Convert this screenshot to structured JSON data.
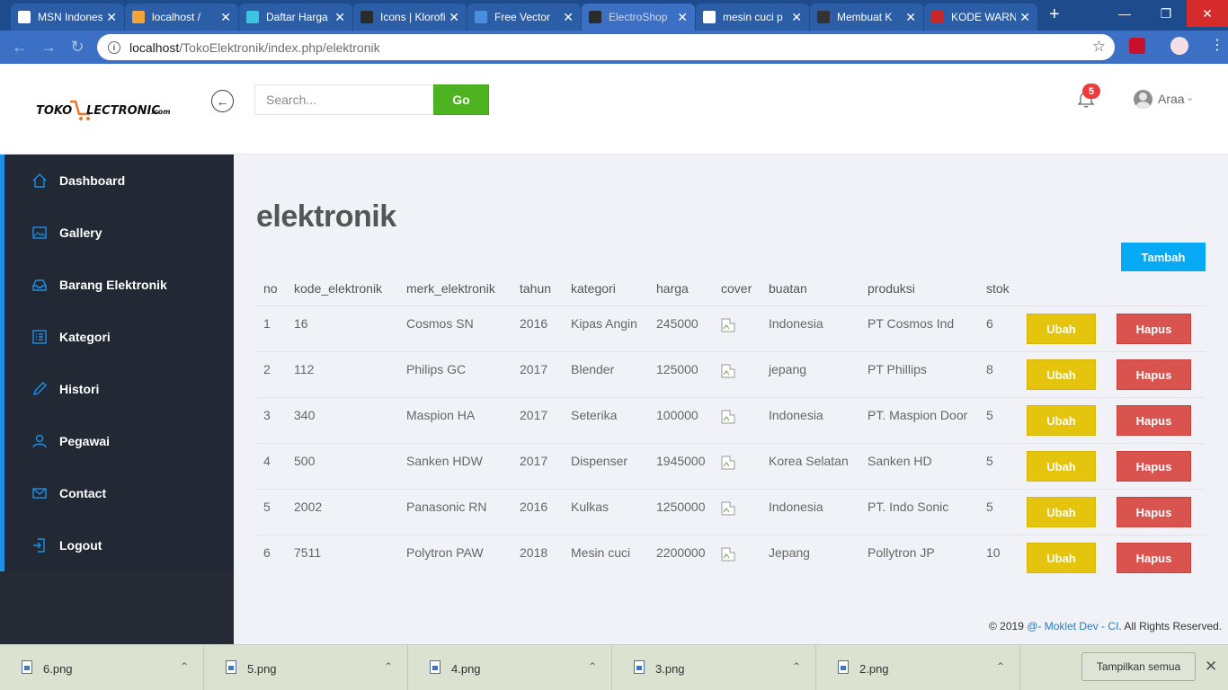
{
  "browser": {
    "tabs": [
      {
        "title": "MSN Indonesia",
        "favicon": "msn-icon",
        "color": "#ffffff"
      },
      {
        "title": "localhost / ",
        "favicon": "phpmyadmin-icon",
        "color": "#f2a33a"
      },
      {
        "title": "Daftar Harga",
        "favicon": "diamond-icon",
        "color": "#3ec4e0"
      },
      {
        "title": "Icons | Klorofil",
        "favicon": "leaf-icon",
        "color": "#2b2b2b"
      },
      {
        "title": "Free Vector",
        "favicon": "gem-icon",
        "color": "#4d8de0"
      },
      {
        "title": "ElectroShop",
        "favicon": "leaf-icon",
        "color": "#2b2b2b"
      },
      {
        "title": "mesin cuci p",
        "favicon": "google-icon",
        "color": "#ffffff"
      },
      {
        "title": "Membuat K",
        "favicon": "jx-icon",
        "color": "#333333"
      },
      {
        "title": "KODE WARNA",
        "favicon": "red-square-icon",
        "color": "#c62828"
      }
    ],
    "url_host": "localhost",
    "url_path": "/TokoElektronik/index.php/elektronik"
  },
  "header": {
    "logo_text": "TOKO ELECTRONIC.com",
    "search_placeholder": "Search...",
    "go_label": "Go",
    "notif_count": "5",
    "user_name": "Araa"
  },
  "sidebar": {
    "items": [
      {
        "label": "Dashboard",
        "icon": "home-icon"
      },
      {
        "label": "Gallery",
        "icon": "image-icon"
      },
      {
        "label": "Barang Elektronik",
        "icon": "inbox-icon"
      },
      {
        "label": "Kategori",
        "icon": "list-icon"
      },
      {
        "label": "Histori",
        "icon": "pencil-icon"
      },
      {
        "label": "Pegawai",
        "icon": "user-icon"
      },
      {
        "label": "Contact",
        "icon": "envelope-icon"
      },
      {
        "label": "Logout",
        "icon": "logout-icon"
      }
    ]
  },
  "main": {
    "title": "elektronik",
    "add_button": "Tambah",
    "columns": [
      "no",
      "kode_elektronik",
      "merk_elektronik",
      "tahun",
      "kategori",
      "harga",
      "cover",
      "buatan",
      "produksi",
      "stok"
    ],
    "rows": [
      [
        "1",
        "16",
        "Cosmos SN",
        "2016",
        "Kipas Angin",
        "245000",
        "",
        "Indonesia",
        "PT Cosmos Ind",
        "6"
      ],
      [
        "2",
        "112",
        "Philips GC",
        "2017",
        "Blender",
        "125000",
        "",
        "jepang",
        "PT Phillips",
        "8"
      ],
      [
        "3",
        "340",
        "Maspion HA",
        "2017",
        "Seterika",
        "100000",
        "",
        "Indonesia",
        "PT. Maspion Door",
        "5"
      ],
      [
        "4",
        "500",
        "Sanken HDW",
        "2017",
        "Dispenser",
        "1945000",
        "",
        "Korea Selatan",
        "Sanken HD",
        "5"
      ],
      [
        "5",
        "2002",
        "Panasonic RN",
        "2016",
        "Kulkas",
        "1250000",
        "",
        "Indonesia",
        "PT. Indo Sonic",
        "5"
      ],
      [
        "6",
        "7511",
        "Polytron PAW",
        "2018",
        "Mesin cuci",
        "2200000",
        "",
        "Jepang",
        "Pollytron JP",
        "10"
      ]
    ],
    "edit_label": "Ubah",
    "delete_label": "Hapus"
  },
  "footer": {
    "prefix": "© 2019 ",
    "link": "@- Moklet Dev - CI",
    "suffix": ". All Rights Reserved."
  },
  "downloads": {
    "files": [
      "6.png",
      "5.png",
      "4.png",
      "3.png",
      "2.png"
    ],
    "show_all": "Tampilkan semua"
  },
  "colors": {
    "accent": "#06a9f4",
    "go": "#4db321",
    "edit": "#e5c40e",
    "delete": "#d9534f",
    "sidebar": "#222834"
  }
}
